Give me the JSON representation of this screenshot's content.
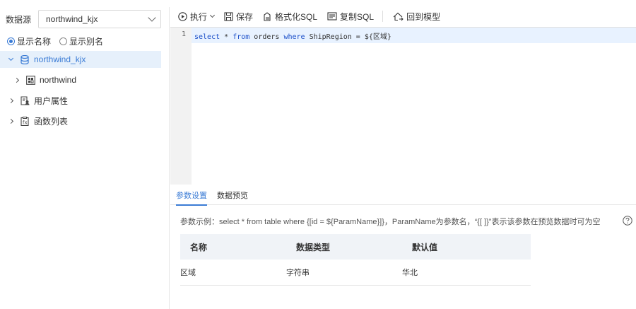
{
  "left": {
    "datasource_label": "数据源",
    "datasource_value": "northwind_kjx",
    "radio_name": "显示名称",
    "radio_alias": "显示别名",
    "tree": [
      {
        "label": "northwind_kjx",
        "expanded": true,
        "selected": true,
        "icon": "database-icon"
      },
      {
        "label": "northwind",
        "expanded": false,
        "selected": false,
        "icon": "schema-icon"
      },
      {
        "label": "用户属性",
        "expanded": false,
        "selected": false,
        "icon": "user-attr-icon"
      },
      {
        "label": "函数列表",
        "expanded": false,
        "selected": false,
        "icon": "function-list-icon"
      }
    ]
  },
  "toolbar": {
    "run": "执行",
    "save": "保存",
    "format": "格式化SQL",
    "copy": "复制SQL",
    "back": "回到模型"
  },
  "editor": {
    "line_number": "1",
    "code_parts": [
      {
        "text": "select",
        "kw": true
      },
      {
        "text": " * ",
        "kw": false
      },
      {
        "text": "from",
        "kw": true
      },
      {
        "text": " orders ",
        "kw": false
      },
      {
        "text": "where",
        "kw": true
      },
      {
        "text": " ShipRegion = ${区域}",
        "kw": false
      }
    ]
  },
  "bottom_tabs": [
    "参数设置",
    "数据预览"
  ],
  "hint": "参数示例：select * from table where {[id = ${ParamName}]}，ParamName为参数名，“{[ ]}”表示该参数在预览数据时可为空",
  "params": {
    "headers": [
      "名称",
      "数据类型",
      "默认值"
    ],
    "rows": [
      [
        "区域",
        "字符串",
        "华北"
      ]
    ]
  },
  "colors": {
    "accent": "#3a7bd5",
    "selected_bg": "#e6f0fb",
    "keyword": "#1a4ec8"
  }
}
